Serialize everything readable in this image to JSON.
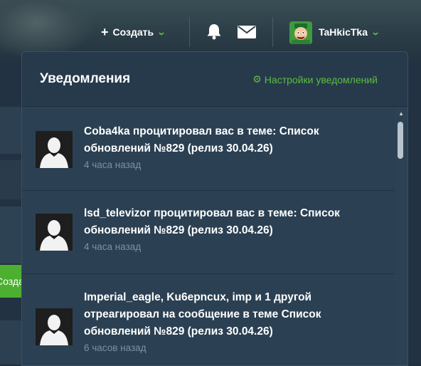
{
  "topbar": {
    "create_plus": "+",
    "create_label": "Создать",
    "chevron": "⌄",
    "username": "TaHkicTka"
  },
  "notifications": {
    "title": "Уведомления",
    "settings_icon": "⚙",
    "settings_label": "Настройки уведомлений",
    "items": [
      {
        "text": "Coba4ka процитировал вас в теме: Список обновлений №829 (релиз 30.04.26)",
        "time": "4 часа назад"
      },
      {
        "text": "lsd_televizor процитировал вас в теме: Список обновлений №829 (релиз 30.04.26)",
        "time": "4 часа назад"
      },
      {
        "text": "Imperial_eagle, Ku6epncux, imp и 1 другой отреагировал на сообщение в теме Список обновлений №829 (релиз 30.04.26)",
        "time": "6 часов назад"
      }
    ]
  },
  "background": {
    "create_button_peek": "Создать"
  },
  "icons": {
    "bell": "bell-icon",
    "mail": "mail-icon",
    "gear": "gear-icon",
    "avatar_placeholder": "default-avatar-icon"
  },
  "colors": {
    "accent_green": "#5dbd3f",
    "panel_bg": "#2a3f52",
    "muted_text": "#7b91a4"
  }
}
